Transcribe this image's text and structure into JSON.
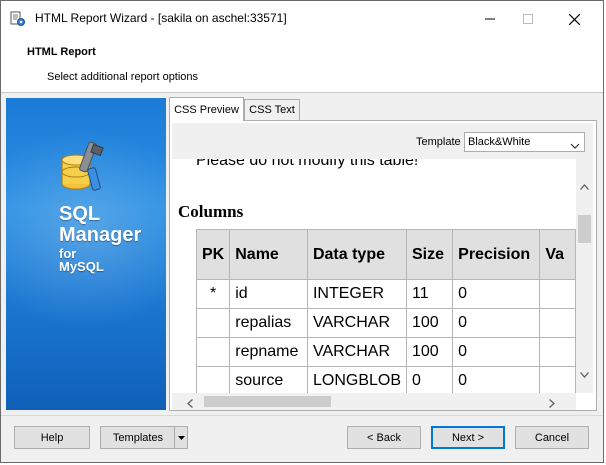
{
  "window": {
    "title": "HTML Report Wizard - [sakila on aschel:33571]",
    "icons": {
      "app": "report-wizard-icon",
      "minimize": "minimize-icon",
      "maximize": "maximize-icon",
      "close": "close-icon"
    }
  },
  "header": {
    "title": "HTML Report",
    "subtitle": "Select additional report options"
  },
  "banner": {
    "line1": "SQL",
    "line2": "Manager",
    "line3": "for",
    "line4": "MySQL",
    "icon": "sql-manager-logo-icon"
  },
  "tabs": [
    {
      "label": "CSS Preview",
      "active": true
    },
    {
      "label": "CSS Text",
      "active": false
    }
  ],
  "template": {
    "label": "Template",
    "selected": "Black&White"
  },
  "preview": {
    "note": "Please do not modify this table!",
    "heading": "Columns",
    "columns": [
      "PK",
      "Name",
      "Data type",
      "Size",
      "Precision",
      "Va"
    ],
    "rows": [
      [
        "*",
        "id",
        "INTEGER",
        "11",
        "0",
        ""
      ],
      [
        "",
        "repalias",
        "VARCHAR",
        "100",
        "0",
        ""
      ],
      [
        "",
        "repname",
        "VARCHAR",
        "100",
        "0",
        ""
      ],
      [
        "",
        "source",
        "LONGBLOB",
        "0",
        "0",
        ""
      ]
    ]
  },
  "buttons": {
    "help": "Help",
    "templates": "Templates",
    "back": "< Back",
    "next": "Next >",
    "cancel": "Cancel"
  },
  "colors": {
    "banner": "#1b7bd7",
    "default_button_border": "#0078d7"
  }
}
